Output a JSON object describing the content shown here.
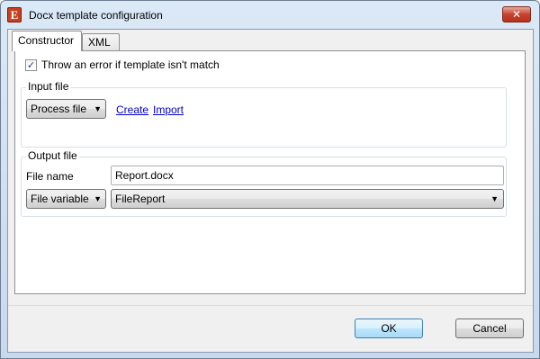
{
  "window": {
    "title": "Docx template configuration",
    "close_label": "✕",
    "app_icon_glyph": "E"
  },
  "tabs": [
    {
      "label": "Constructor",
      "selected": true
    },
    {
      "label": "XML",
      "selected": false
    }
  ],
  "constructor": {
    "throw_error": {
      "label": "Throw an error if template isn't match",
      "checked": true
    },
    "input_file": {
      "legend": "Input file",
      "mode_select": "Process file",
      "create_link": "Create",
      "import_link": "Import"
    },
    "output_file": {
      "legend": "Output file",
      "file_name_label": "File name",
      "file_name_value": "Report.docx",
      "mode_select": "File variable",
      "variable_value": "FileReport"
    }
  },
  "buttons": {
    "ok": "OK",
    "cancel": "Cancel"
  },
  "colors": {
    "titlebar": "#c6d9ee",
    "close_button": "#c7432d",
    "link": "#0000cc"
  }
}
